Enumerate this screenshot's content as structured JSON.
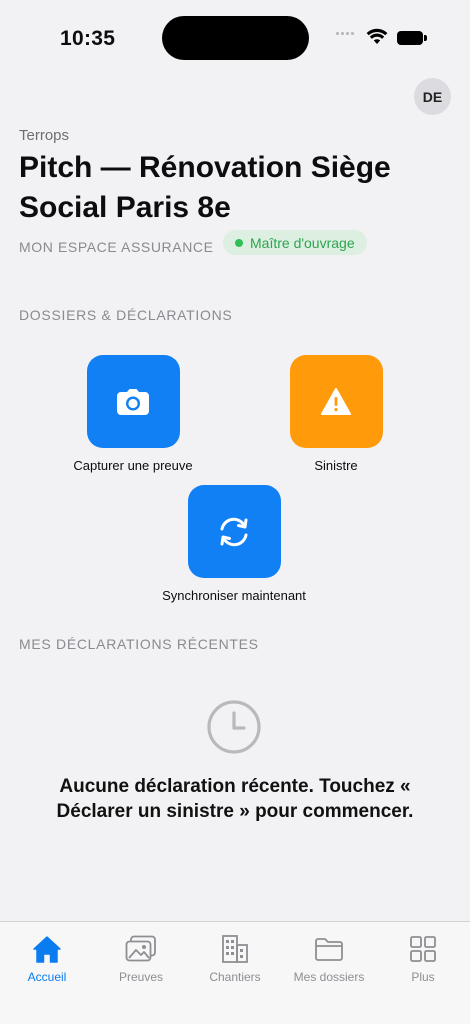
{
  "status_bar": {
    "time": "10:35"
  },
  "header": {
    "avatar_initials": "DE",
    "org": "Terrops",
    "title": "Pitch — Rénovation Siège Social Paris 8e",
    "subtitle": "MON ESPACE ASSURANCE",
    "role_badge": "Maître d'ouvrage"
  },
  "sections": {
    "dossiers_title": "DOSSIERS & DÉCLARATIONS",
    "recent_title": "MES DÉCLARATIONS RÉCENTES"
  },
  "actions": [
    {
      "label": "Capturer une preuve",
      "icon": "camera-icon",
      "color": "#1280f5"
    },
    {
      "label": "Sinistre",
      "icon": "warning-icon",
      "color": "#ff9a0a"
    },
    {
      "label": "Synchroniser maintenant",
      "icon": "sync-icon",
      "color": "#1280f5"
    }
  ],
  "empty_state": {
    "icon": "clock-icon",
    "message": "Aucune déclaration récente. Touchez « Déclarer un sinistre » pour commencer."
  },
  "tabs": [
    {
      "label": "Accueil",
      "icon": "home-icon",
      "active": true
    },
    {
      "label": "Preuves",
      "icon": "photo-icon",
      "active": false
    },
    {
      "label": "Chantiers",
      "icon": "building-icon",
      "active": false
    },
    {
      "label": "Mes dossiers",
      "icon": "folder-icon",
      "active": false
    },
    {
      "label": "Plus",
      "icon": "grid-icon",
      "active": false
    }
  ],
  "colors": {
    "accent": "#0a7cf0",
    "warning": "#ff9a0a",
    "success": "#2fbf56"
  }
}
